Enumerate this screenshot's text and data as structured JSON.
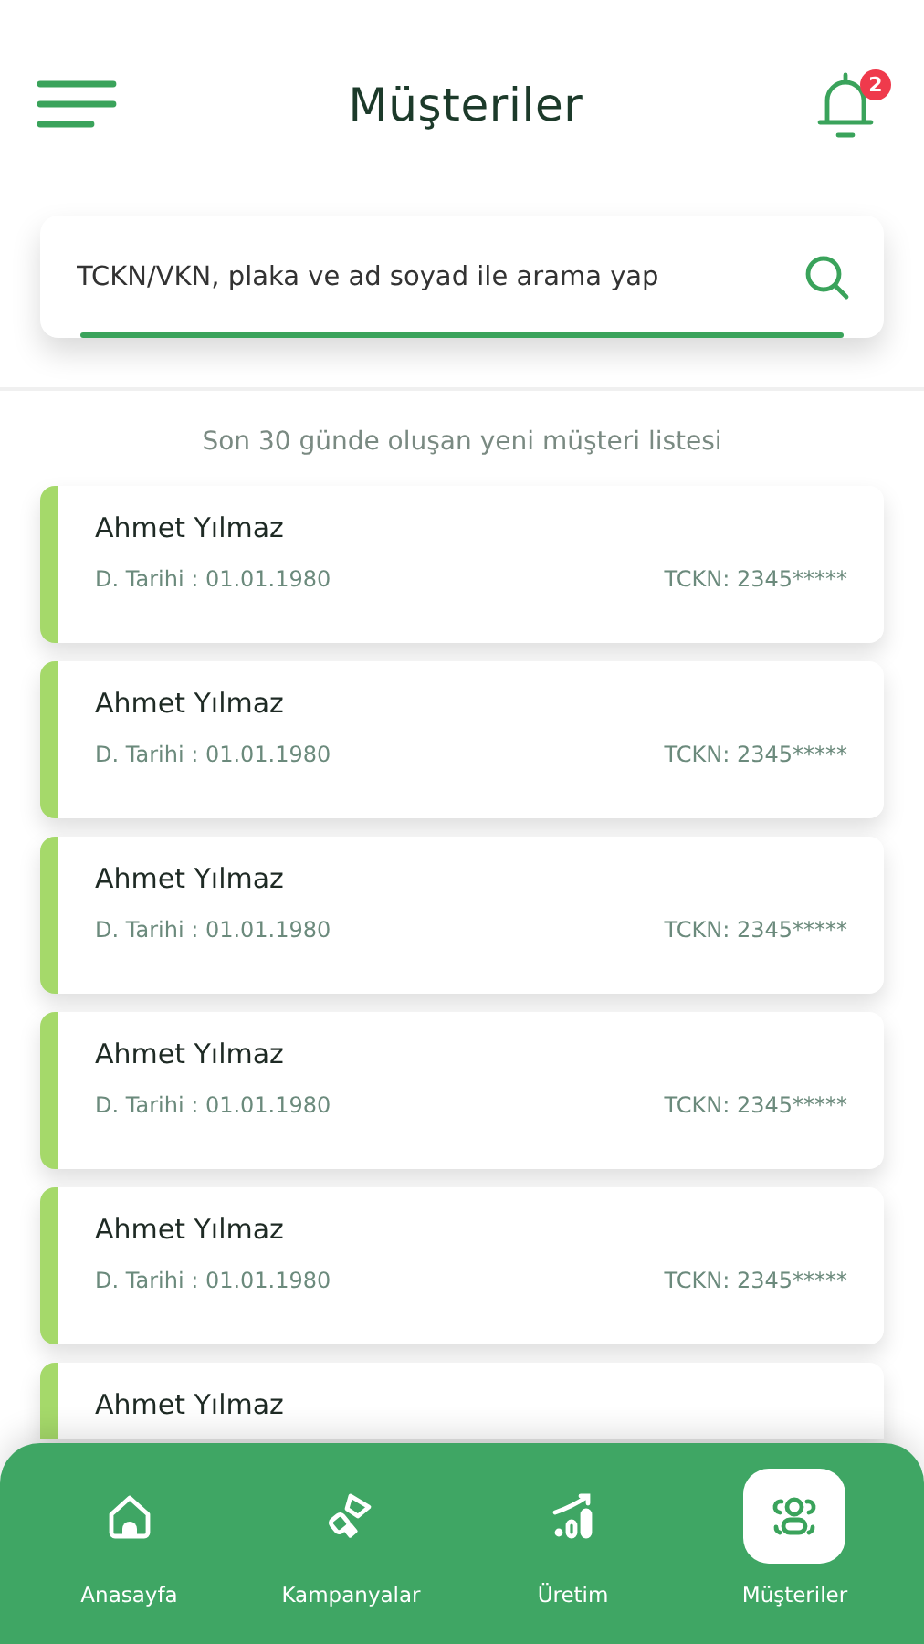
{
  "header": {
    "title": "Müşteriler",
    "notification_count": "2"
  },
  "search": {
    "placeholder": "TCKN/VKN, plaka ve ad soyad ile arama yap"
  },
  "list_caption": "Son 30 günde oluşan yeni müşteri listesi",
  "customers": [
    {
      "name": "Ahmet Yılmaz",
      "birth_date": "D. Tarihi : 01.01.1980",
      "id_number": "TCKN: 2345*****"
    },
    {
      "name": "Ahmet Yılmaz",
      "birth_date": "D. Tarihi : 01.01.1980",
      "id_number": "TCKN: 2345*****"
    },
    {
      "name": "Ahmet Yılmaz",
      "birth_date": "D. Tarihi : 01.01.1980",
      "id_number": "TCKN: 2345*****"
    },
    {
      "name": "Ahmet Yılmaz",
      "birth_date": "D. Tarihi : 01.01.1980",
      "id_number": "TCKN: 2345*****"
    },
    {
      "name": "Ahmet Yılmaz",
      "birth_date": "D. Tarihi : 01.01.1980",
      "id_number": "TCKN: 2345*****"
    },
    {
      "name": "Ahmet Yılmaz"
    }
  ],
  "bottom_nav": [
    {
      "kind": "home",
      "label": "Anasayfa",
      "selected": false
    },
    {
      "kind": "campaign",
      "label": "Kampanyalar",
      "selected": false
    },
    {
      "kind": "production",
      "label": "Üretim",
      "selected": false
    },
    {
      "kind": "customers",
      "label": "Müşteriler",
      "selected": true
    }
  ]
}
